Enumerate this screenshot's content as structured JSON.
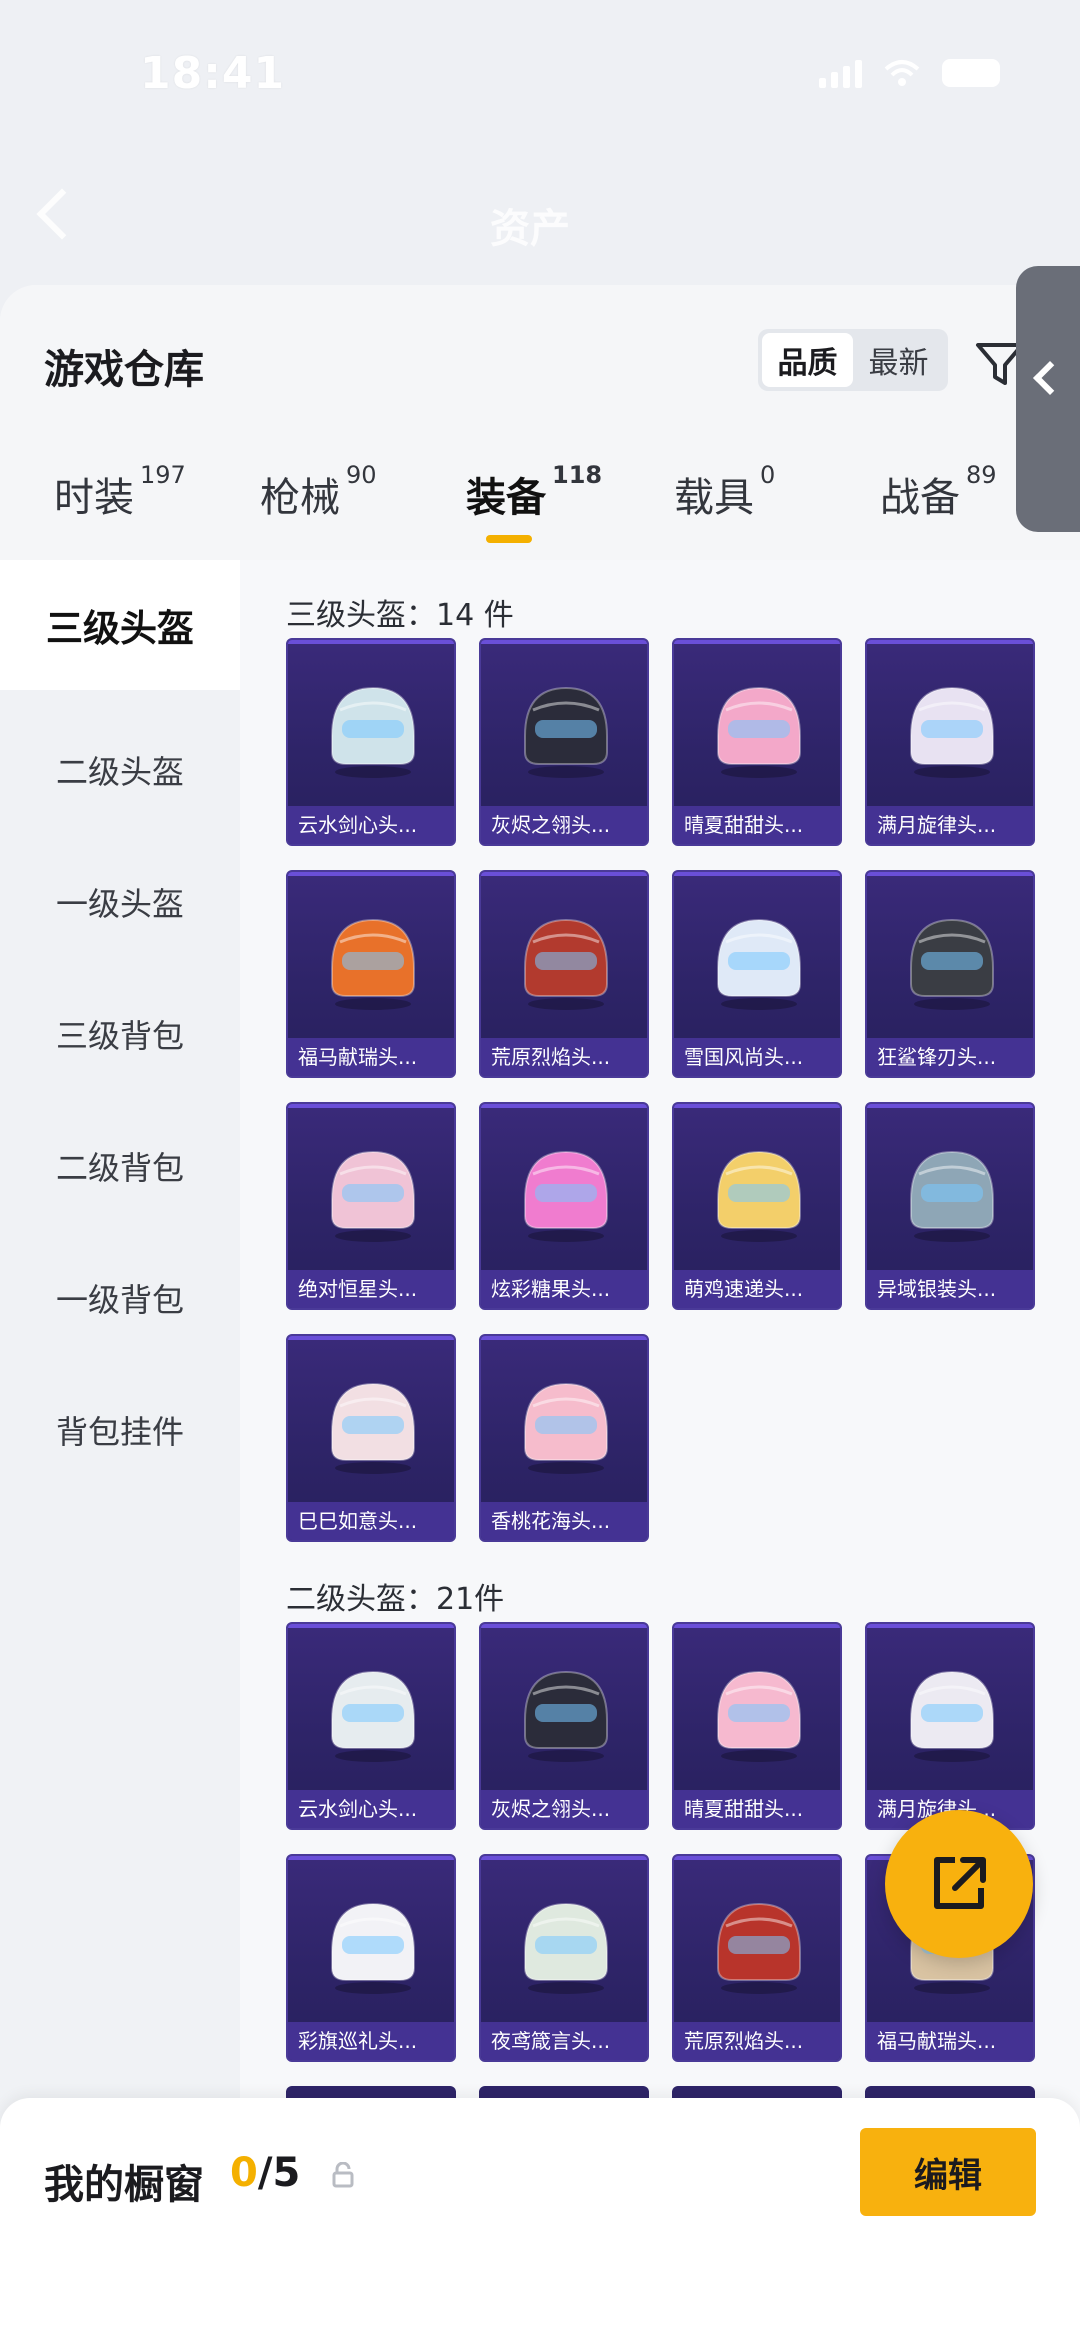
{
  "status": {
    "time": "18:41",
    "battery": ""
  },
  "bg_header": {
    "title": "资产"
  },
  "sheet": {
    "title": "游戏仓库",
    "sort": {
      "quality": "品质",
      "newest": "最新"
    }
  },
  "tabs": [
    {
      "label": "时装",
      "count": "197"
    },
    {
      "label": "枪械",
      "count": "90"
    },
    {
      "label": "装备",
      "count": "118"
    },
    {
      "label": "载具",
      "count": "0"
    },
    {
      "label": "战备",
      "count": "89"
    }
  ],
  "nav": [
    {
      "label": "三级头盔"
    },
    {
      "label": "二级头盔"
    },
    {
      "label": "一级头盔"
    },
    {
      "label": "三级背包"
    },
    {
      "label": "二级背包"
    },
    {
      "label": "一级背包"
    },
    {
      "label": "背包挂件"
    }
  ],
  "sections": [
    {
      "title": "三级头盔：14 件",
      "items": [
        {
          "name": "云水剑心头...",
          "color": "#cfe3ea"
        },
        {
          "name": "灰烬之翎头...",
          "color": "#2b2c3a"
        },
        {
          "name": "晴夏甜甜头...",
          "color": "#f3a8c9"
        },
        {
          "name": "满月旋律头...",
          "color": "#e8e2f2"
        },
        {
          "name": "福马献瑞头...",
          "color": "#e8712a"
        },
        {
          "name": "荒原烈焰头...",
          "color": "#b23a2e"
        },
        {
          "name": "雪国风尚头...",
          "color": "#dfe9f7"
        },
        {
          "name": "狂鲨锋刃头...",
          "color": "#3a3d44"
        },
        {
          "name": "绝对恒星头...",
          "color": "#f0c3d6"
        },
        {
          "name": "炫彩糖果头...",
          "color": "#f07ccf"
        },
        {
          "name": "萌鸡速递头...",
          "color": "#f3cf6a"
        },
        {
          "name": "异域银装头...",
          "color": "#8ea6b6"
        },
        {
          "name": "巳巳如意头...",
          "color": "#f2dfe3"
        },
        {
          "name": "香桃花海头...",
          "color": "#f6bccc"
        }
      ]
    },
    {
      "title": "二级头盔：21件",
      "items": [
        {
          "name": "云水剑心头...",
          "color": "#e6ecef"
        },
        {
          "name": "灰烬之翎头...",
          "color": "#2b2c3a"
        },
        {
          "name": "晴夏甜甜头...",
          "color": "#f6b9cf"
        },
        {
          "name": "满月旋律头...",
          "color": "#eceaf2"
        },
        {
          "name": "彩旗巡礼头...",
          "color": "#f2f2f6"
        },
        {
          "name": "夜鸢箴言头...",
          "color": "#dfe9df"
        },
        {
          "name": "荒原烈焰头...",
          "color": "#b8342b"
        },
        {
          "name": "福马献瑞头...",
          "color": "#d9c3a2"
        }
      ]
    }
  ],
  "showcase": {
    "title": "我的橱窗",
    "current": "0",
    "total": "/5",
    "edit": "编辑"
  }
}
